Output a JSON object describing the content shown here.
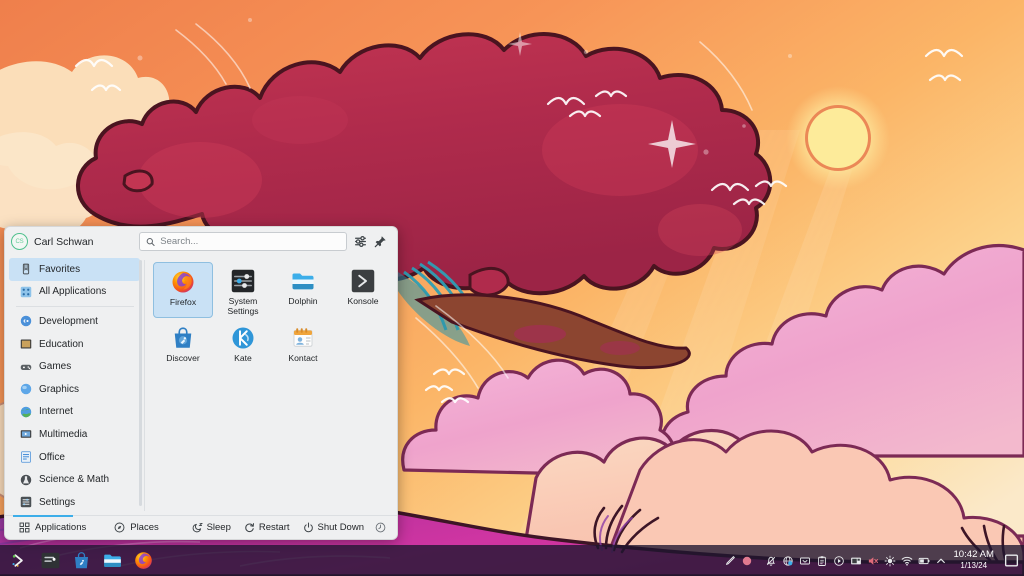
{
  "desktop": {
    "wallpaper_name": "kde-sunset-clouds",
    "colors": {
      "sky_top": "#f2864f",
      "sky_mid": "#f9a75f",
      "sky_warm": "#fbd089",
      "sky_pale": "#fbe8c6",
      "sun_fill": "#fdeb9a",
      "sun_ring": "#e8734a",
      "tree_red": "#b62a4e",
      "tree_red_light": "#d83f56",
      "tree_outline": "#4a1420",
      "cloud_pink": "#f0a8cf",
      "cloud_peach": "#f8c5b2",
      "cloud_cream": "#fbe6c8",
      "ground_magenta": "#c8309a",
      "ground_purple": "#6e3fa0",
      "outline_dark": "#3d1526",
      "teal_leaf": "#2f9fb5"
    }
  },
  "launcher": {
    "user": {
      "name": "Carl Schwan",
      "initials": "CS",
      "avatar_ring": "#4fc08d"
    },
    "search": {
      "placeholder": "Search...",
      "value": ""
    },
    "header_buttons": [
      {
        "name": "configure-icon",
        "label": "Configure"
      },
      {
        "name": "pin-icon",
        "label": "Pin"
      }
    ],
    "sidebar": {
      "top": [
        {
          "label": "Favorites",
          "icon": "bookmark-icon",
          "selected": true
        },
        {
          "label": "All Applications",
          "icon": "grid-apps-icon",
          "selected": false
        }
      ],
      "categories": [
        {
          "label": "Development",
          "icon": "development-icon"
        },
        {
          "label": "Education",
          "icon": "education-icon"
        },
        {
          "label": "Games",
          "icon": "games-icon"
        },
        {
          "label": "Graphics",
          "icon": "graphics-icon"
        },
        {
          "label": "Internet",
          "icon": "internet-icon"
        },
        {
          "label": "Multimedia",
          "icon": "multimedia-icon"
        },
        {
          "label": "Office",
          "icon": "office-icon"
        },
        {
          "label": "Science & Math",
          "icon": "science-icon"
        },
        {
          "label": "Settings",
          "icon": "settings-icon"
        }
      ]
    },
    "apps": [
      {
        "label": "Firefox",
        "icon": "firefox-icon",
        "selected": true
      },
      {
        "label": "System Settings",
        "icon": "system-settings-icon",
        "selected": false
      },
      {
        "label": "Dolphin",
        "icon": "dolphin-icon",
        "selected": false
      },
      {
        "label": "Konsole",
        "icon": "konsole-icon",
        "selected": false
      },
      {
        "label": "Discover",
        "icon": "discover-icon",
        "selected": false
      },
      {
        "label": "Kate",
        "icon": "kate-icon",
        "selected": false
      },
      {
        "label": "Kontact",
        "icon": "kontact-icon",
        "selected": false
      }
    ],
    "footer": {
      "tabs": [
        {
          "label": "Applications",
          "icon": "grid-icon",
          "active": true
        },
        {
          "label": "Places",
          "icon": "places-icon",
          "active": false
        }
      ],
      "power": [
        {
          "label": "Sleep",
          "icon": "sleep-icon"
        },
        {
          "label": "Restart",
          "icon": "restart-icon"
        },
        {
          "label": "Shut Down",
          "icon": "shutdown-icon"
        }
      ],
      "extra": {
        "label": "Leave",
        "icon": "clock-leave-icon"
      }
    }
  },
  "panel": {
    "launcher_button": {
      "name": "kde-launcher-icon",
      "label": "Application Launcher"
    },
    "tasks": [
      {
        "label": "Konsole",
        "icon": "konsole-icon"
      },
      {
        "label": "Discover",
        "icon": "discover-icon"
      },
      {
        "label": "Dolphin",
        "icon": "dolphin-icon"
      },
      {
        "label": "Firefox",
        "icon": "firefox-icon"
      }
    ],
    "tray": [
      {
        "label": "Screen Marker",
        "icon": "pen-icon"
      },
      {
        "label": "Recording",
        "icon": "record-circle-icon"
      },
      {
        "label": "Notifications",
        "icon": "bell-muted-icon"
      },
      {
        "label": "Updates",
        "icon": "update-globe-icon"
      },
      {
        "label": "Keyboard Layout",
        "icon": "keyboard-icon"
      },
      {
        "label": "Clipboard",
        "icon": "clipboard-icon"
      },
      {
        "label": "Media Player",
        "icon": "media-play-icon"
      },
      {
        "label": "Display Configuration",
        "icon": "display-icon"
      },
      {
        "label": "Volume",
        "icon": "volume-muted-icon"
      },
      {
        "label": "Brightness",
        "icon": "brightness-icon"
      },
      {
        "label": "Networks",
        "icon": "wifi-icon"
      },
      {
        "label": "Battery",
        "icon": "battery-icon",
        "value": "46%"
      },
      {
        "label": "Show hidden icons",
        "icon": "chevron-up-icon"
      }
    ],
    "clock": {
      "time": "10:42 AM",
      "date": "1/13/24"
    },
    "show_desktop": {
      "label": "Show Desktop",
      "icon": "show-desktop-icon"
    }
  }
}
